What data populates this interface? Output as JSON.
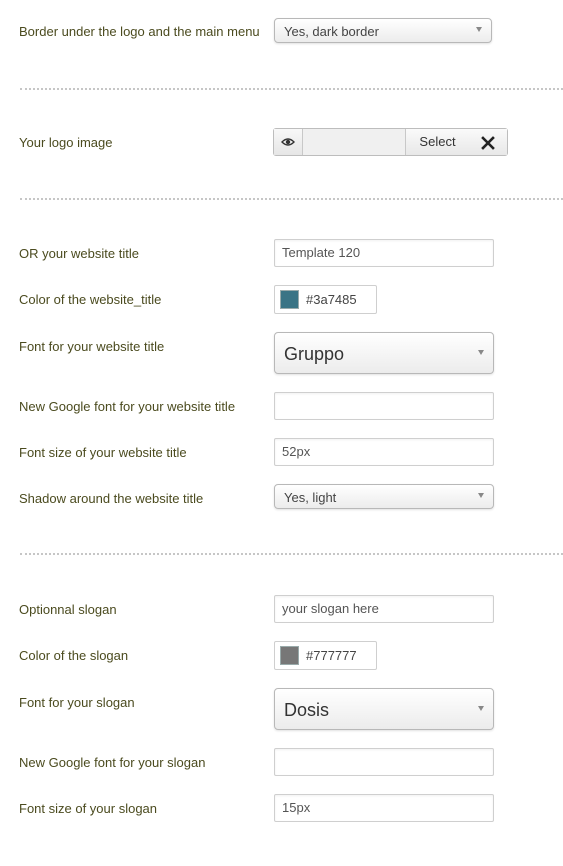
{
  "rows": {
    "border": {
      "label": "Border under the logo and the main menu",
      "value": "Yes, dark border"
    },
    "logo": {
      "label": "Your logo image",
      "select_label": "Select"
    },
    "site_title": {
      "label": "OR your website title",
      "value": "Template 120"
    },
    "title_color": {
      "label": "Color of the website_title",
      "value": "#3a7485",
      "swatch": "#3a7485"
    },
    "title_font": {
      "label": "Font for your website title",
      "value": "Gruppo"
    },
    "title_google_font": {
      "label": "New Google font for your website title",
      "value": ""
    },
    "title_font_size": {
      "label": "Font size of your website title",
      "value": "52px"
    },
    "title_shadow": {
      "label": "Shadow around the website title",
      "value": "Yes, light"
    },
    "slogan": {
      "label": "Optionnal slogan",
      "value": "your slogan here"
    },
    "slogan_color": {
      "label": "Color of the slogan",
      "value": "#777777",
      "swatch": "#777777"
    },
    "slogan_font": {
      "label": "Font for your slogan",
      "value": "Dosis"
    },
    "slogan_google_font": {
      "label": "New Google font for your slogan",
      "value": ""
    },
    "slogan_font_size": {
      "label": "Font size of your slogan",
      "value": "15px"
    }
  },
  "icons": {
    "preview": "eye-icon",
    "clear": "close-icon"
  }
}
